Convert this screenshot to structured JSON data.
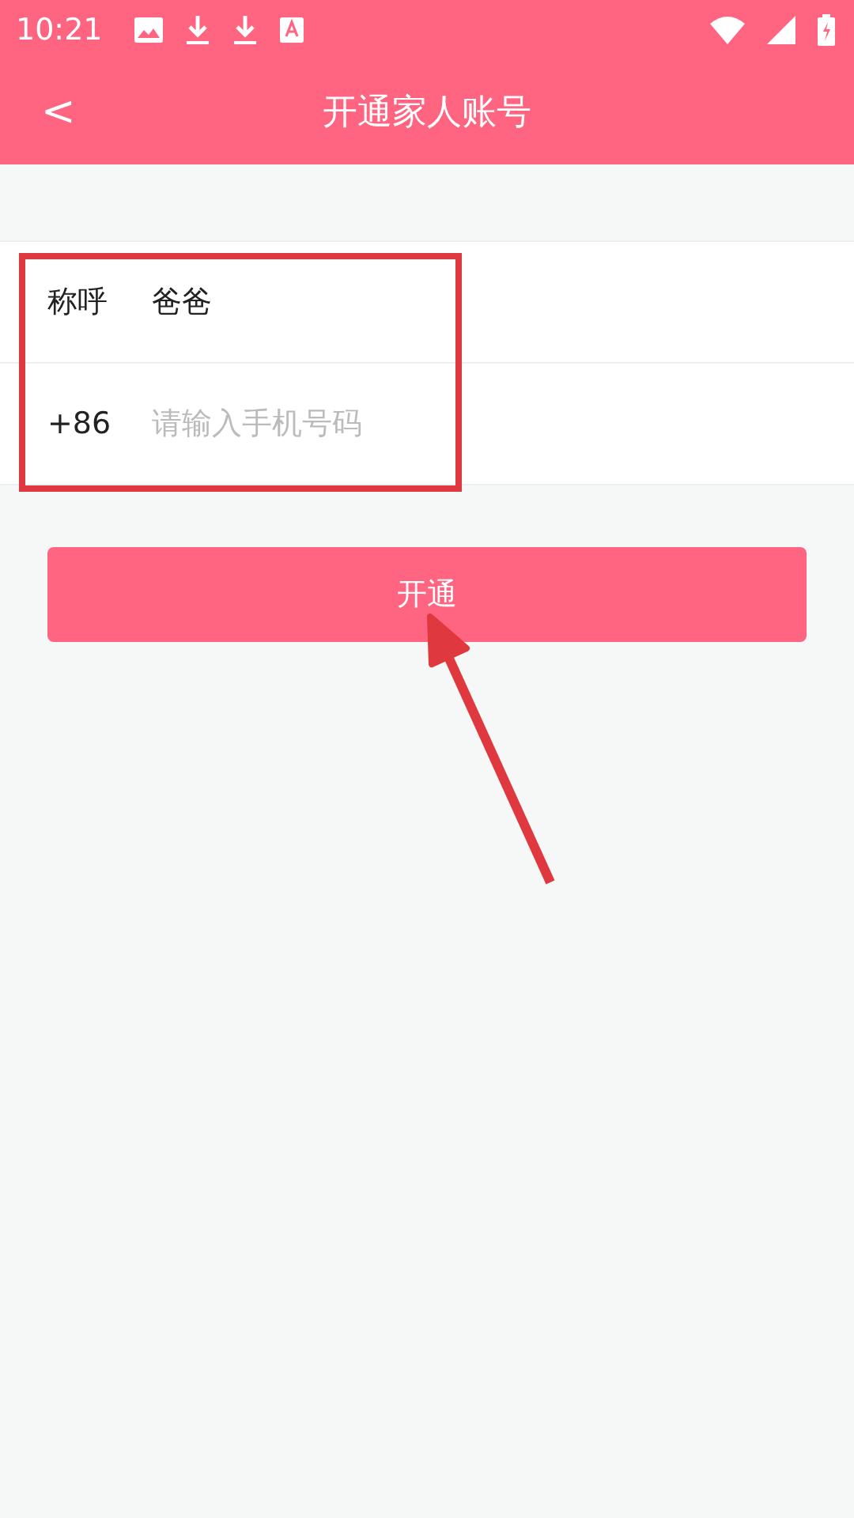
{
  "status_bar": {
    "time": "10:21"
  },
  "header": {
    "back": "<",
    "title": "开通家人账号"
  },
  "form": {
    "rows": [
      {
        "kind": "text",
        "label": "称呼",
        "value": "爸爸"
      },
      {
        "kind": "phone",
        "label": "+86",
        "placeholder": "请输入手机号码"
      }
    ]
  },
  "submit_button": {
    "label": "开通"
  }
}
